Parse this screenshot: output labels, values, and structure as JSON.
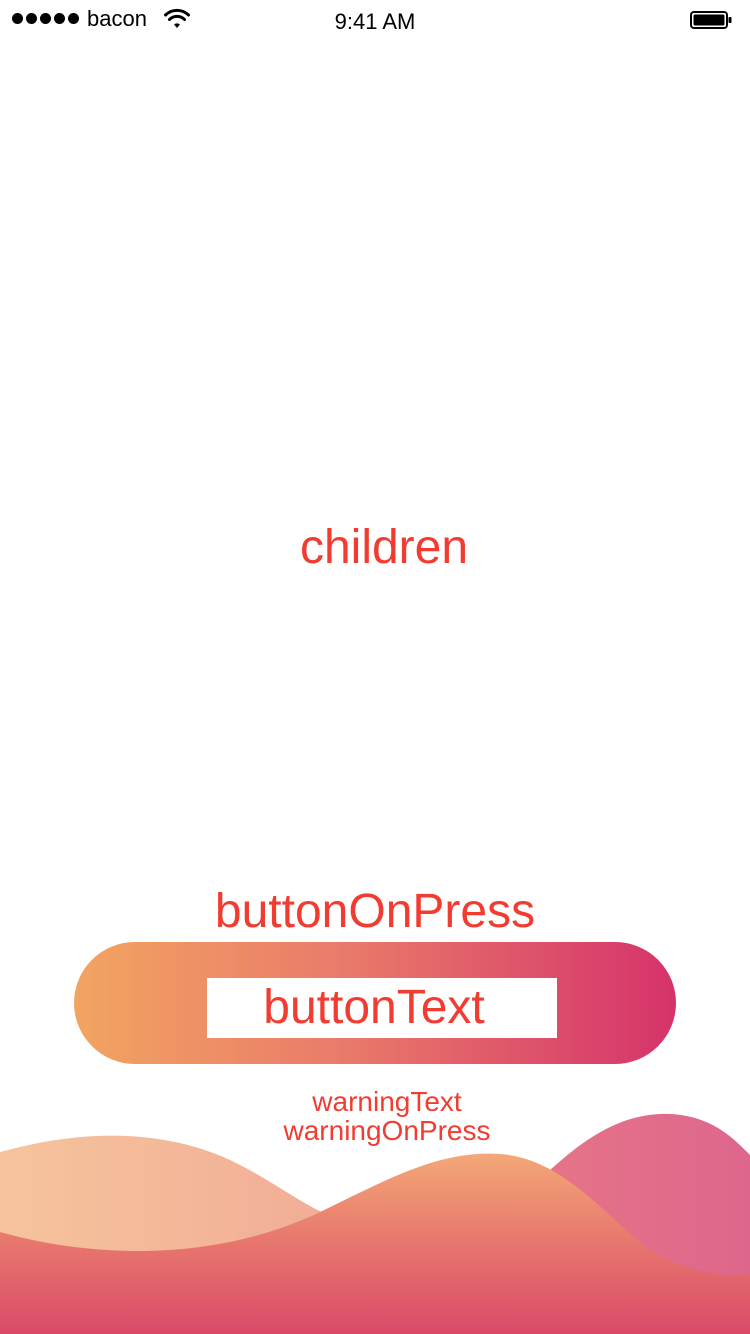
{
  "status_bar": {
    "carrier": "bacon",
    "time": "9:41 AM"
  },
  "content": {
    "children_label": "children"
  },
  "actions": {
    "button_on_press_label": "buttonOnPress",
    "button_text": "buttonText",
    "warning_text": "warningText",
    "warning_on_press": "warningOnPress"
  },
  "colors": {
    "text_accent": "#f23c32",
    "button_gradient_start": "#f2a461",
    "button_gradient_end": "#d5336a"
  },
  "icons": {
    "signal": "signal-dots-icon",
    "wifi": "wifi-icon",
    "battery": "battery-icon"
  }
}
